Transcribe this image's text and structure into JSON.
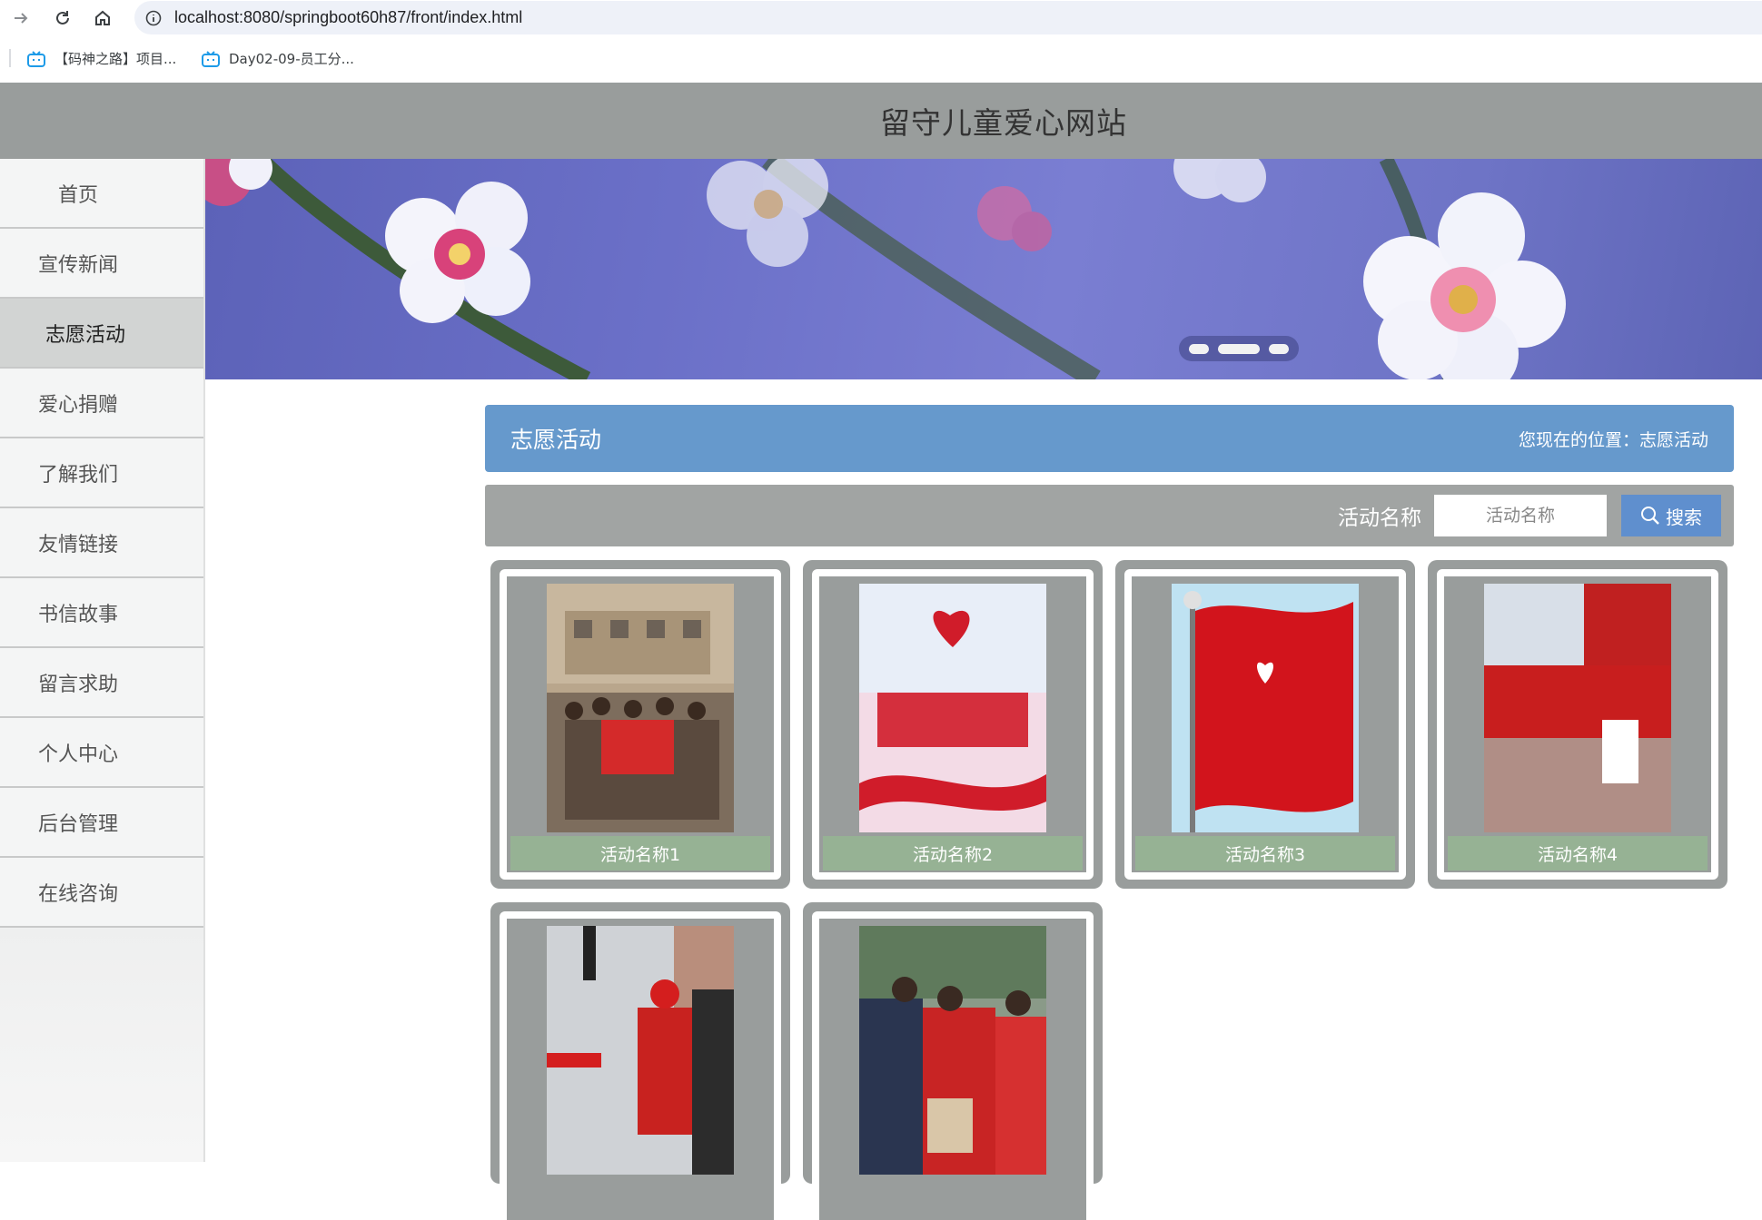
{
  "browser": {
    "url": "localhost:8080/springboot60h87/front/index.html",
    "bookmarks": [
      {
        "label": "【码神之路】项目..."
      },
      {
        "label": "Day02-09-员工分..."
      }
    ]
  },
  "site": {
    "title": "留守儿童爱心网站"
  },
  "sidebar": {
    "items": [
      {
        "label": "首页"
      },
      {
        "label": "宣传新闻"
      },
      {
        "label": "志愿活动"
      },
      {
        "label": "爱心捐赠"
      },
      {
        "label": "了解我们"
      },
      {
        "label": "友情链接"
      },
      {
        "label": "书信故事"
      },
      {
        "label": "留言求助"
      },
      {
        "label": "个人中心"
      },
      {
        "label": "后台管理"
      },
      {
        "label": "在线咨询"
      }
    ],
    "active": "志愿活动"
  },
  "banner": {
    "slide_count": 3,
    "active_slide": 2
  },
  "section": {
    "title": "志愿活动",
    "location": "您现在的位置：志愿活动"
  },
  "search": {
    "label": "活动名称",
    "placeholder": "活动名称",
    "button": "搜索"
  },
  "cards": [
    {
      "caption": "活动名称1"
    },
    {
      "caption": "活动名称2"
    },
    {
      "caption": "活动名称3"
    },
    {
      "caption": "活动名称4"
    },
    {
      "caption": ""
    },
    {
      "caption": ""
    }
  ],
  "colors": {
    "header_bg": "#999d9c",
    "title_bar": "#6699cc",
    "search_btn": "#5f8fce",
    "caption_bg": "#96b294"
  }
}
